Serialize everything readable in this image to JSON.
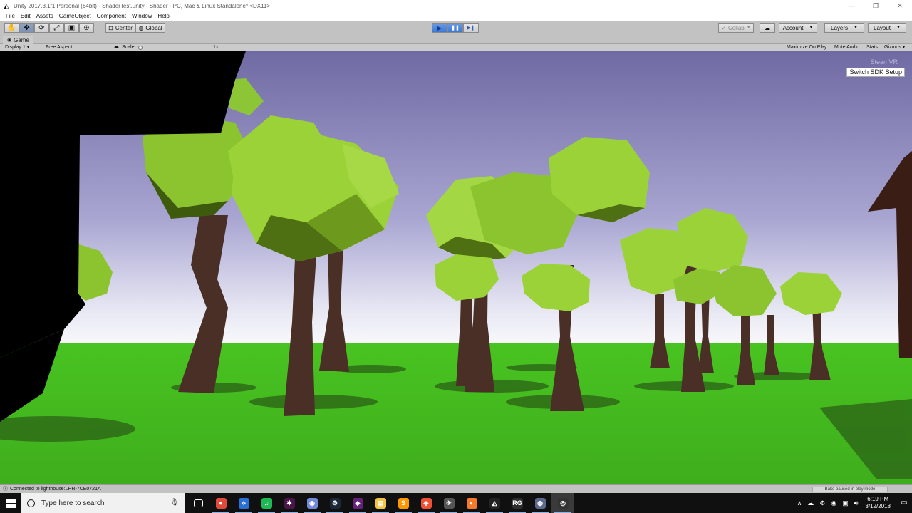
{
  "window": {
    "title": "Unity 2017.3.1f1 Personal (64bit) - ShaderTest.unity - Shader - PC, Mac & Linux Standalone* <DX11>",
    "controls": [
      "minimize",
      "restore",
      "close"
    ]
  },
  "menu": {
    "items": [
      "File",
      "Edit",
      "Assets",
      "GameObject",
      "Component",
      "Window",
      "Help"
    ]
  },
  "toolbar": {
    "tools": [
      {
        "name": "hand-tool",
        "glyph": "✋",
        "icon": "hand-icon"
      },
      {
        "name": "move-tool",
        "glyph": "✥",
        "icon": "move-icon"
      },
      {
        "name": "rotate-tool",
        "glyph": "⟳",
        "icon": "rotate-icon"
      },
      {
        "name": "scale-tool",
        "glyph": "⤢",
        "icon": "scale-icon"
      },
      {
        "name": "rect-tool",
        "glyph": "▣",
        "icon": "rect-icon"
      },
      {
        "name": "transform-tool",
        "glyph": "⊛",
        "icon": "transform-icon"
      }
    ],
    "pivot_label": "Center",
    "pivot_rotation_label": "Global",
    "play": {
      "play_glyph": "▶",
      "pause_glyph": "❚❚",
      "step_glyph": "▶❙"
    },
    "collab_label": "Collab",
    "cloud_glyph": "☁",
    "account_label": "Account",
    "layers_label": "Layers",
    "layout_label": "Layout"
  },
  "game_view": {
    "tab_label": "Game",
    "display_label": "Display 1",
    "aspect_label": "Free Aspect",
    "scale_label": "Scale",
    "scale_value": "1x",
    "maximize_label": "Maximize On Play",
    "mute_label": "Mute Audio",
    "stats_label": "Stats",
    "gizmos_label": "Gizmos"
  },
  "overlay": {
    "steamvr_label": "SteamVR",
    "switch_sdk_label": "Switch SDK Setup"
  },
  "status": {
    "message": "Connected to lighthouse:LHR-7CE0721A",
    "bake_status": "Bake paused in play mode"
  },
  "taskbar": {
    "search_placeholder": "Type here to search",
    "apps": [
      {
        "name": "task-view",
        "glyph": "▭",
        "color": "#101010"
      },
      {
        "name": "chrome",
        "glyph": "●",
        "color": "#e04a3a"
      },
      {
        "name": "unknown-blue-app",
        "glyph": "⟡",
        "color": "#2a6fd6"
      },
      {
        "name": "spotify",
        "glyph": "♫",
        "color": "#1db954"
      },
      {
        "name": "slack",
        "glyph": "✱",
        "color": "#4a154b"
      },
      {
        "name": "discord",
        "glyph": "◉",
        "color": "#7289da"
      },
      {
        "name": "steam",
        "glyph": "⚙",
        "color": "#1b2838"
      },
      {
        "name": "visual-studio",
        "glyph": "◆",
        "color": "#68217a"
      },
      {
        "name": "file-explorer",
        "glyph": "▤",
        "color": "#f4c542"
      },
      {
        "name": "sublime-text",
        "glyph": "S",
        "color": "#ff9800"
      },
      {
        "name": "git",
        "glyph": "◈",
        "color": "#f05033"
      },
      {
        "name": "unknown-app",
        "glyph": "✈",
        "color": "#555555"
      },
      {
        "name": "blender",
        "glyph": "◐",
        "color": "#f5792a"
      },
      {
        "name": "unity",
        "glyph": "◭",
        "color": "#222222"
      },
      {
        "name": "rg-app",
        "glyph": "RG",
        "color": "#2d2d2d"
      },
      {
        "name": "browser-app",
        "glyph": "◍",
        "color": "#5b6a8c"
      },
      {
        "name": "unity-hub",
        "glyph": "◎",
        "color": "#333333"
      }
    ],
    "time": "6:19 PM",
    "date": "3/12/2018"
  }
}
